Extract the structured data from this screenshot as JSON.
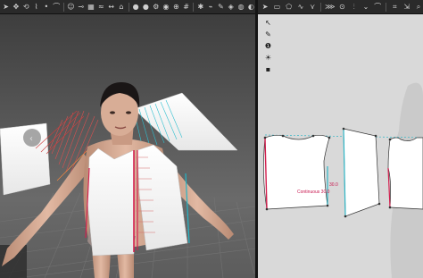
{
  "toolbar_3d": {
    "icons": [
      "select-icon",
      "move-icon",
      "rotate-icon",
      "sewing-icon",
      "pin-icon",
      "fold-icon",
      "avatar-icon",
      "measure-icon",
      "texture-icon",
      "wind-icon",
      "stretch-icon",
      "hanger-icon",
      "dot-icon",
      "dot-icon",
      "settings-icon",
      "camera-icon",
      "snap-icon",
      "grid-icon",
      "light-icon",
      "bone-icon",
      "paint-icon",
      "mesh-icon",
      "record-icon",
      "view-icon"
    ]
  },
  "toolbar_2d": {
    "icons": [
      "select-icon",
      "rect-icon",
      "polygon-icon",
      "curve-icon",
      "dart-icon",
      "pleat-icon",
      "button-icon",
      "seam-icon",
      "notch-icon",
      "fold-icon",
      "trace-icon",
      "grade-icon",
      "zoom-icon"
    ]
  },
  "window_2d": {
    "tools": [
      "pointer-icon",
      "edit-pen-icon",
      "circle-tool-icon",
      "brush-tool-icon",
      "square-tool-icon"
    ],
    "segment_labels": [
      "Continuous 30.0",
      "30.0"
    ]
  },
  "colors": {
    "toolbar_bg": "#2a2a2a",
    "viewport_bg": "#505050",
    "pattern_bg": "#d9d9d9",
    "seam_red": "#d3204f",
    "seam_cyan": "#22b6c8",
    "fabric": "#f4f4f4"
  }
}
